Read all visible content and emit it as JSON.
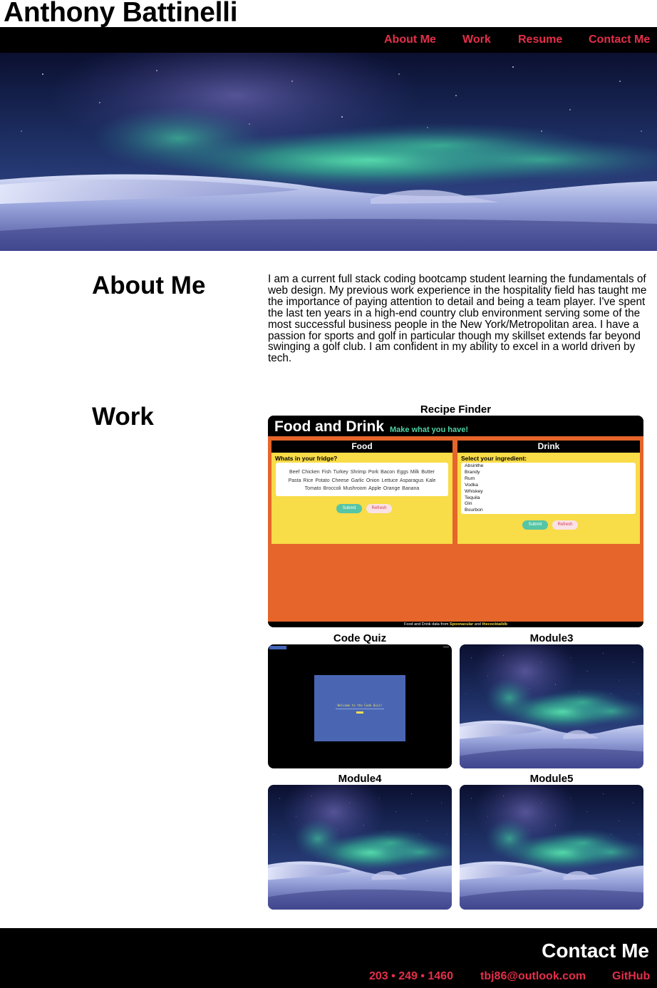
{
  "header": {
    "name": "Anthony Battinelli",
    "nav": [
      {
        "label": "About Me"
      },
      {
        "label": "Work"
      },
      {
        "label": "Resume"
      },
      {
        "label": "Contact Me"
      }
    ]
  },
  "about": {
    "title": "About Me",
    "text": "I am a current full stack coding bootcamp student learning the fundamentals of web design. My previous work experience in the hospitality field has taught me the importance of paying attention to detail and being a team player. I've spent the last ten years in a high-end country club environment serving some of the most successful business people in the New York/Metropolitan area. I have a passion for sports and golf in particular though my skillset extends far beyond swinging a golf club. I am confident in my ability to excel in a world driven by tech."
  },
  "work": {
    "title": "Work",
    "projects": [
      {
        "title": "Recipe Finder"
      },
      {
        "title": "Code Quiz"
      },
      {
        "title": "Module3"
      },
      {
        "title": "Module4"
      },
      {
        "title": "Module5"
      }
    ],
    "recipe_preview": {
      "app_title": "Food and Drink",
      "tagline": "Make what you have!",
      "food_tab": "Food",
      "drink_tab": "Drink",
      "food_prompt": "Whats in your fridge?",
      "drink_prompt": "Select your ingredient:",
      "food_items": "Beef  Chicken  Fish  Turkey  Shrimp  Pork  Bacon  Eggs  Milk  Butter  Pasta  Rice  Potato  Cheese  Garlic  Onion  Lettuce  Asparagus  Kale  Tomato  Broccoli  Mushroom  Apple  Orange  Banana",
      "drink_items": [
        "Absinthe",
        "Brandy",
        "Rum",
        "Vodka",
        "Whiskey",
        "Tequila",
        "Gin",
        "Bourbon"
      ],
      "submit_label": "Submit",
      "refresh_label": "Refresh",
      "footer_prefix": "Food and Drink data from",
      "footer_source1": "Spoonacular",
      "footer_and": "and",
      "footer_source2": "thecocktaildb"
    },
    "quiz_preview": {
      "welcome": "Welcome to the Code Quiz!"
    }
  },
  "footer": {
    "title": "Contact Me",
    "phone": "203 • 249 • 1460",
    "email": "tbj86@outlook.com",
    "github": "GitHub"
  },
  "colors": {
    "accent": "#e42f4a",
    "nav_bg": "#000000"
  }
}
